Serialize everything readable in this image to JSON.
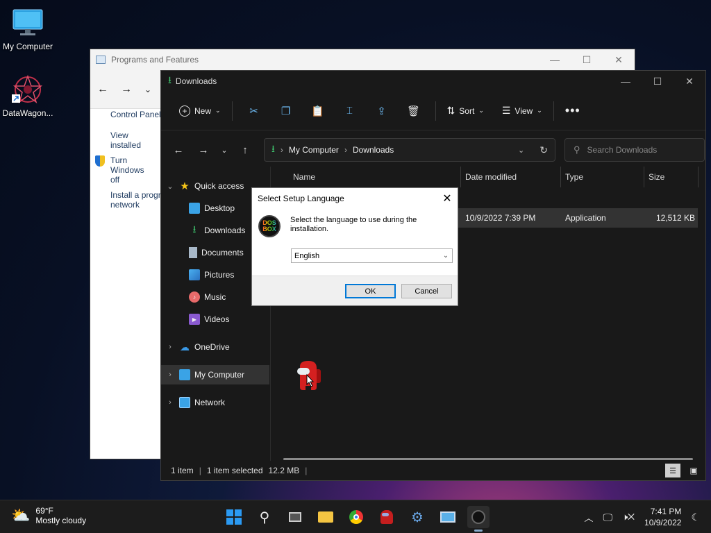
{
  "desktop": {
    "icons": [
      {
        "label": "My Computer",
        "icon": "monitor-icon"
      },
      {
        "label": "DataWagon...",
        "icon": "datawagon-icon"
      }
    ]
  },
  "programs_features": {
    "title": "Programs and Features",
    "side_links": [
      "Control Panel",
      "View installed",
      "Turn Windows",
      "off",
      "Install a progr",
      "network"
    ]
  },
  "explorer": {
    "title": "Downloads",
    "toolbar": {
      "new_label": "New",
      "sort_label": "Sort",
      "view_label": "View"
    },
    "breadcrumb": [
      "My Computer",
      "Downloads"
    ],
    "search_placeholder": "Search Downloads",
    "nav": {
      "quick_access": "Quick access",
      "desktop": "Desktop",
      "downloads": "Downloads",
      "documents": "Documents",
      "pictures": "Pictures",
      "music": "Music",
      "videos": "Videos",
      "onedrive": "OneDrive",
      "my_computer": "My Computer",
      "network": "Network"
    },
    "columns": {
      "name": "Name",
      "date": "Date modified",
      "type": "Type",
      "size": "Size"
    },
    "files": [
      {
        "date": "10/9/2022 7:39 PM",
        "type": "Application",
        "size": "12,512 KB"
      }
    ],
    "status": {
      "items": "1 item",
      "selected": "1 item selected",
      "size": "12.2 MB"
    }
  },
  "dialog": {
    "title": "Select Setup Language",
    "message": "Select the language to use during the installation.",
    "selected_language": "English",
    "logo_text": "DOS BOX",
    "ok": "OK",
    "cancel": "Cancel"
  },
  "taskbar": {
    "weather_temp": "69°F",
    "weather_desc": "Mostly cloudy",
    "time": "7:41 PM",
    "date": "10/9/2022"
  },
  "colors": {
    "accent": "#0078d7",
    "explorer_bg": "#191919",
    "taskbar_bg": "#1c1c1c"
  }
}
